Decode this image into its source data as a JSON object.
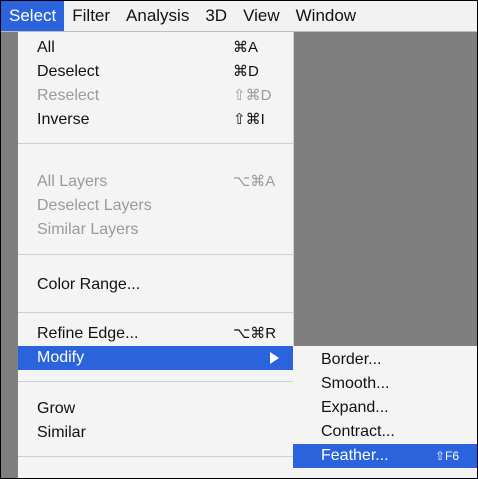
{
  "menubar": [
    "Select",
    "Filter",
    "Analysis",
    "3D",
    "View",
    "Window"
  ],
  "colors": {
    "accent": "#2b63dc",
    "menu_bg": "#f4f4f4",
    "canvas": "#7f7f7f",
    "disabled": "#9a9a9a"
  },
  "select_menu": {
    "items": [
      {
        "label": "All",
        "shortcut": "⌘A"
      },
      {
        "label": "Deselect",
        "shortcut": "⌘D"
      },
      {
        "label": "Reselect",
        "shortcut": "⇧⌘D"
      },
      {
        "label": "Inverse",
        "shortcut": "⇧⌘I"
      },
      {
        "label": "All Layers",
        "shortcut": "⌥⌘A"
      },
      {
        "label": "Deselect Layers",
        "shortcut": ""
      },
      {
        "label": "Similar Layers",
        "shortcut": ""
      },
      {
        "label": "Color Range...",
        "shortcut": ""
      },
      {
        "label": "Refine Edge...",
        "shortcut": "⌥⌘R"
      },
      {
        "label": "Modify",
        "shortcut": ""
      },
      {
        "label": "Grow",
        "shortcut": ""
      },
      {
        "label": "Similar",
        "shortcut": ""
      }
    ]
  },
  "modify_submenu": {
    "items": [
      {
        "label": "Border...",
        "shortcut": ""
      },
      {
        "label": "Smooth...",
        "shortcut": ""
      },
      {
        "label": "Expand...",
        "shortcut": ""
      },
      {
        "label": "Contract...",
        "shortcut": ""
      },
      {
        "label": "Feather...",
        "shortcut": "⇧F6"
      }
    ]
  }
}
